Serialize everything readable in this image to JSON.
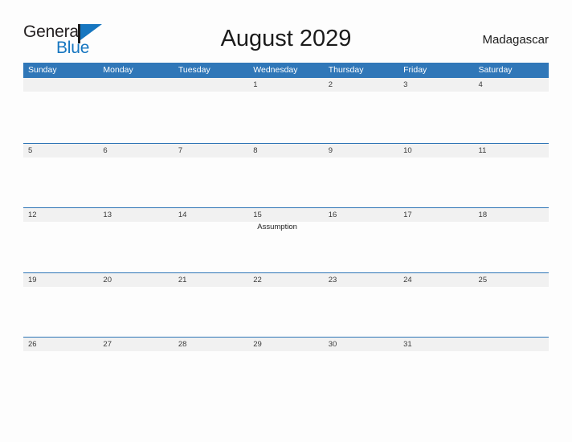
{
  "brand": {
    "name_top": "General",
    "name_bottom": "Blue",
    "flag_icon": "flag-triangle-icon",
    "accent_color": "#1676c0"
  },
  "header": {
    "title": "August 2029",
    "country": "Madagascar"
  },
  "theme": {
    "header_blue": "#3077b8",
    "row_border_blue": "#2e75b6",
    "band_gray": "#f1f1f1",
    "page_background": "#fdfdfd",
    "text_dark": "#1b1b1b"
  },
  "calendar": {
    "month": "August",
    "year": "2029",
    "weekday_headers": [
      "Sunday",
      "Monday",
      "Tuesday",
      "Wednesday",
      "Thursday",
      "Friday",
      "Saturday"
    ],
    "weeks": [
      [
        {
          "day": "",
          "events": []
        },
        {
          "day": "",
          "events": []
        },
        {
          "day": "",
          "events": []
        },
        {
          "day": "1",
          "events": []
        },
        {
          "day": "2",
          "events": []
        },
        {
          "day": "3",
          "events": []
        },
        {
          "day": "4",
          "events": []
        }
      ],
      [
        {
          "day": "5",
          "events": []
        },
        {
          "day": "6",
          "events": []
        },
        {
          "day": "7",
          "events": []
        },
        {
          "day": "8",
          "events": []
        },
        {
          "day": "9",
          "events": []
        },
        {
          "day": "10",
          "events": []
        },
        {
          "day": "11",
          "events": []
        }
      ],
      [
        {
          "day": "12",
          "events": []
        },
        {
          "day": "13",
          "events": []
        },
        {
          "day": "14",
          "events": []
        },
        {
          "day": "15",
          "events": [
            "Assumption"
          ]
        },
        {
          "day": "16",
          "events": []
        },
        {
          "day": "17",
          "events": []
        },
        {
          "day": "18",
          "events": []
        }
      ],
      [
        {
          "day": "19",
          "events": []
        },
        {
          "day": "20",
          "events": []
        },
        {
          "day": "21",
          "events": []
        },
        {
          "day": "22",
          "events": []
        },
        {
          "day": "23",
          "events": []
        },
        {
          "day": "24",
          "events": []
        },
        {
          "day": "25",
          "events": []
        }
      ],
      [
        {
          "day": "26",
          "events": []
        },
        {
          "day": "27",
          "events": []
        },
        {
          "day": "28",
          "events": []
        },
        {
          "day": "29",
          "events": []
        },
        {
          "day": "30",
          "events": []
        },
        {
          "day": "31",
          "events": []
        },
        {
          "day": "",
          "events": []
        }
      ]
    ]
  }
}
